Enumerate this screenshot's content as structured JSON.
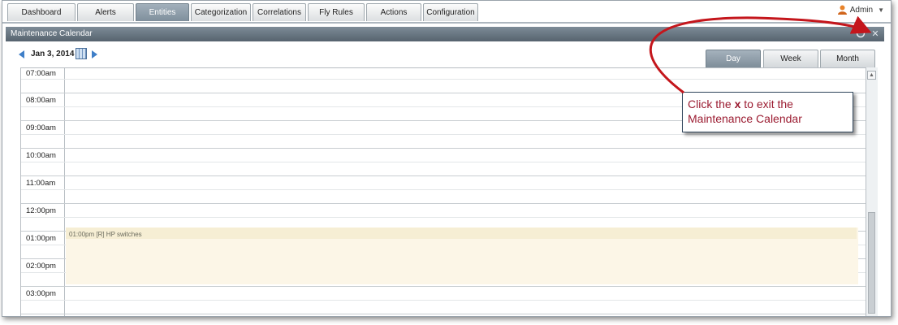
{
  "nav": {
    "tabs": [
      {
        "label": "Dashboard",
        "active": false
      },
      {
        "label": "Alerts",
        "active": false
      },
      {
        "label": "Entities",
        "active": true
      },
      {
        "label": "Categorization",
        "active": false
      },
      {
        "label": "Correlations",
        "active": false
      },
      {
        "label": "Fly Rules",
        "active": false
      },
      {
        "label": "Actions",
        "active": false
      },
      {
        "label": "Configuration",
        "active": false
      }
    ],
    "user": {
      "name": "Admin",
      "icon": "user-icon",
      "menu_icon": "chevron-down-icon"
    }
  },
  "panel": {
    "title": "Maintenance Calendar",
    "refresh_icon": "refresh-icon",
    "close_icon": "close-icon"
  },
  "toolbar": {
    "date": "Jan 3, 2014",
    "prev_icon": "arrow-left-icon",
    "next_icon": "arrow-right-icon",
    "calendar_icon": "calendar-icon"
  },
  "view_tabs": [
    {
      "label": "Day",
      "active": true
    },
    {
      "label": "Week",
      "active": false
    },
    {
      "label": "Month",
      "active": false
    }
  ],
  "calendar": {
    "times": [
      "07:00am",
      "08:00am",
      "09:00am",
      "10:00am",
      "11:00am",
      "12:00pm",
      "01:00pm",
      "02:00pm",
      "03:00pm"
    ],
    "event": {
      "label": "01:00pm [R] HP switches"
    }
  },
  "callout": {
    "text_before": "Click the ",
    "emphasis": "x",
    "text_after": " to exit the Maintenance Calendar"
  },
  "colors": {
    "active_tab": "#8a98a4",
    "header_bar": "#5f6c77",
    "event_fill": "#fcf6e7",
    "callout_text": "#9b1c31",
    "annotation_arrow": "#c4161c"
  }
}
